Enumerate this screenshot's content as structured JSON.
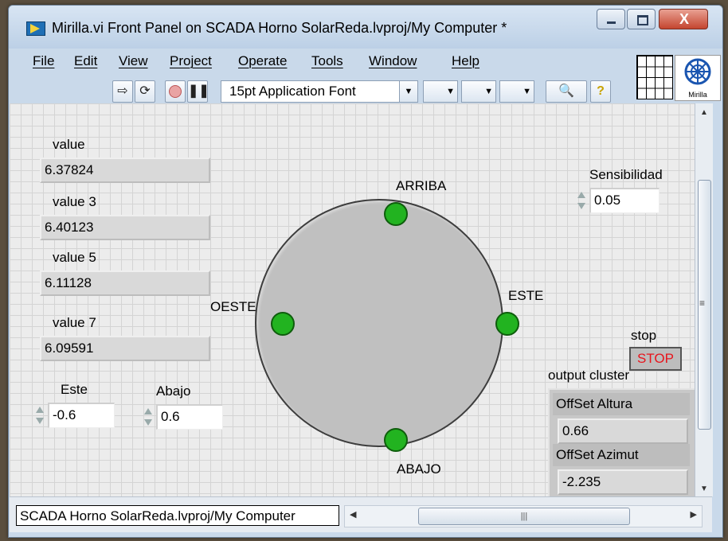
{
  "window": {
    "title": "Mirilla.vi Front Panel on SCADA Horno SolarReda.lvproj/My Computer *",
    "close_glyph": "X"
  },
  "menu": [
    "File",
    "Edit",
    "View",
    "Project",
    "Operate",
    "Tools",
    "Window",
    "Help"
  ],
  "toolbar": {
    "font": "15pt Application Font",
    "icons": [
      "run-arrow-icon",
      "run-continuous-icon",
      "abort-icon",
      "pause-icon",
      "align-icon",
      "distribute-icon",
      "resize-icon",
      "reorder-icon",
      "search-icon",
      "help-icon"
    ]
  },
  "vi_icon_label": "Mirilla",
  "indicators": [
    {
      "label": "value",
      "value": "6.37824"
    },
    {
      "label": "value 3",
      "value": "6.40123"
    },
    {
      "label": "value 5",
      "value": "6.11128"
    },
    {
      "label": "value 7",
      "value": "6.09591"
    }
  ],
  "controls": {
    "este": {
      "label": "Este",
      "value": "-0.6"
    },
    "abajo": {
      "label": "Abajo",
      "value": "0.6"
    },
    "sensibilidad": {
      "label": "Sensibilidad",
      "value": "0.05"
    }
  },
  "dial": {
    "top": "ARRIBA",
    "bottom": "ABAJO",
    "left": "OESTE",
    "right": "ESTE",
    "led_color": "#22b320"
  },
  "stop": {
    "label": "stop",
    "button": "STOP",
    "text_color": "#e8141c"
  },
  "output_cluster": {
    "label": "output cluster",
    "altura_label": "OffSet Altura",
    "altura_value": "0.66",
    "azimut_label": "OffSet  Azimut",
    "azimut_value": "-2.235"
  },
  "status_path": "SCADA Horno SolarReda.lvproj/My Computer"
}
